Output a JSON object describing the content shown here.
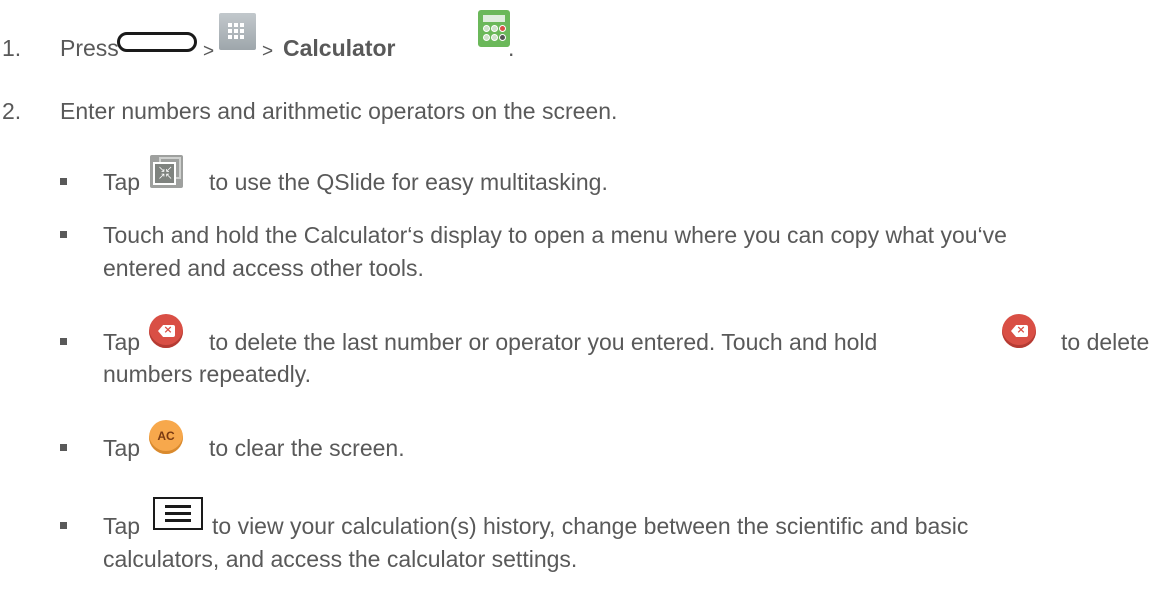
{
  "steps": [
    {
      "number": "1.",
      "parts": {
        "press": "Press",
        "sep1": ">",
        "sep2": ">",
        "app": "Calculator",
        "end": "."
      }
    },
    {
      "number": "2.",
      "text": "Enter numbers and arithmetic operators on the screen."
    }
  ],
  "bullets": {
    "qslide": {
      "tap": "Tap",
      "text": "to use the QSlide for easy multitasking."
    },
    "hold": {
      "line1": "Touch and hold the Calculator‘s display to open a menu where you can copy what you‘ve",
      "line2": "entered and access other tools."
    },
    "delete": {
      "tap": "Tap",
      "text_a": "to delete the last number or operator you entered. Touch and hold",
      "text_b": "to delete",
      "line2": "numbers repeatedly."
    },
    "clear": {
      "tap": "Tap",
      "text": "to clear the screen."
    },
    "menu": {
      "tap": "Tap",
      "line1": "to view your calculation(s) history, change between the scientific and basic",
      "line2": "calculators, and access the calculator settings."
    }
  },
  "icons": {
    "home": "home-button-icon",
    "apps": "apps-grid-icon",
    "calculator": "calculator-app-icon",
    "qslide": "qslide-icon",
    "delete": "delete-backspace-icon",
    "clear": "ac-clear-icon",
    "menu": "menu-icon",
    "ac_label": "AC"
  },
  "colors": {
    "text": "#595959",
    "delete": "#d94f45",
    "clear": "#f7a84c",
    "calculator": "#6bb85a"
  }
}
